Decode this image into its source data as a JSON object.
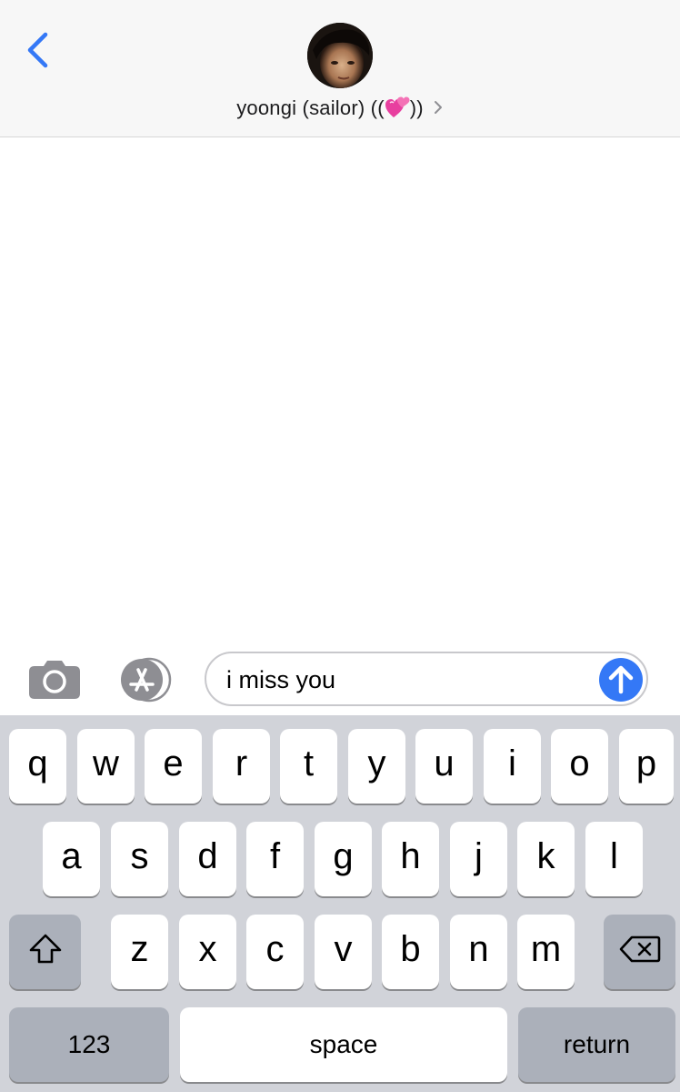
{
  "header": {
    "contact_name": "yoongi (sailor) ((",
    "contact_name_suffix": "))",
    "heart_emoji_icon": "two-hearts-icon",
    "chevron_icon": "chevron-right-icon",
    "back_icon": "chevron-left-icon",
    "accent_color": "#3478f6"
  },
  "input_bar": {
    "camera_icon": "camera-icon",
    "appstore_icon": "appstore-icon",
    "message_value": "i miss you",
    "send_icon": "arrow-up-icon"
  },
  "keyboard": {
    "row1": [
      "q",
      "w",
      "e",
      "r",
      "t",
      "y",
      "u",
      "i",
      "o",
      "p"
    ],
    "row2": [
      "a",
      "s",
      "d",
      "f",
      "g",
      "h",
      "j",
      "k",
      "l"
    ],
    "row3": [
      "z",
      "x",
      "c",
      "v",
      "b",
      "n",
      "m"
    ],
    "shift_icon": "shift-icon",
    "delete_icon": "backspace-icon",
    "numbers_label": "123",
    "space_label": "space",
    "return_label": "return"
  }
}
